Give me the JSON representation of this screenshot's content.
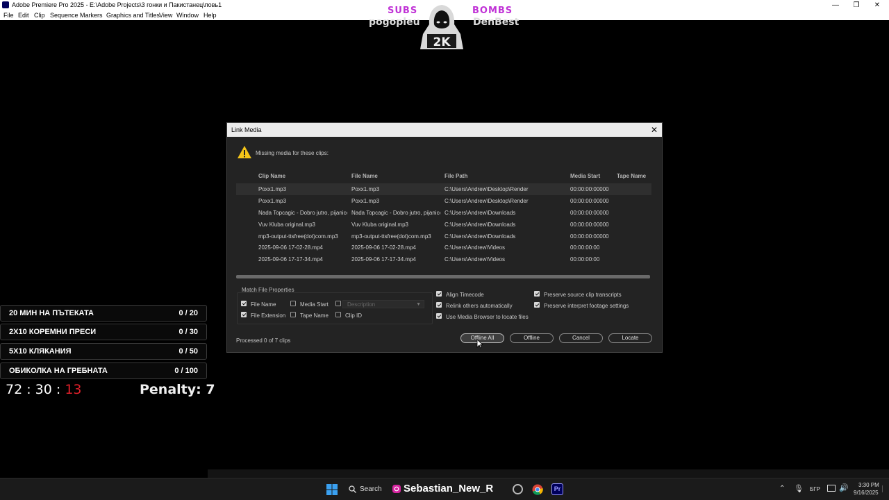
{
  "window": {
    "title": "Adobe Premiere Pro 2025 - E:\\Adobe Projects\\3 гонки и Пакистанец\\повь1",
    "controls": {
      "minimize": "—",
      "maximize": "❐",
      "close": "✕"
    }
  },
  "menu": [
    "File",
    "Edit",
    "Clip",
    "Sequence",
    "Markers",
    "Graphics and Titles",
    "View",
    "Window",
    "Help"
  ],
  "overlay": {
    "subs_label": "SUBS",
    "bombs_label": "BOMBS",
    "subs_name": "pogopleu",
    "bombs_name": "DenBest",
    "mascot_text": "2K",
    "challenges": [
      {
        "label": "20 МИН НА ПЪТЕКАТА",
        "count": "0 / 20"
      },
      {
        "label": "2X10 КОРЕМНИ ПРЕСИ",
        "count": "0 / 30"
      },
      {
        "label": "5X10 КЛЯКАНИЯ",
        "count": "0 / 50"
      },
      {
        "label": "ОБИКОЛКА НА ГРЕБНАТА",
        "count": "0 / 100"
      }
    ],
    "timer_main": "72 : 30 :",
    "timer_red": "13",
    "penalty": "Penalty: 7"
  },
  "dialog": {
    "title": "Link Media",
    "close": "✕",
    "message": "Missing media for these clips:",
    "columns": [
      "Clip Name",
      "File Name",
      "File Path",
      "Media Start",
      "Tape Name"
    ],
    "rows": [
      {
        "clip": "Poxx1.mp3",
        "file": "Poxx1.mp3",
        "path": "C:\\Users\\Andrew\\Desktop\\Render",
        "start": "00:00:00:00000",
        "tape": ""
      },
      {
        "clip": "Poxx1.mp3",
        "file": "Poxx1.mp3",
        "path": "C:\\Users\\Andrew\\Desktop\\Render",
        "start": "00:00:00:00000",
        "tape": ""
      },
      {
        "clip": "Nada Topcagic - Dobro jutro, pijanice -",
        "file": "Nada Topcagic - Dobro jutro, pijanice -",
        "path": "C:\\Users\\Andrew\\Downloads",
        "start": "00:00:00:00000",
        "tape": ""
      },
      {
        "clip": "Vuv Kluba original.mp3",
        "file": "Vuv Kluba original.mp3",
        "path": "C:\\Users\\Andrew\\Downloads",
        "start": "00:00:00:00000",
        "tape": ""
      },
      {
        "clip": "mp3-output-ttsfree(dot)com.mp3",
        "file": "mp3-output-ttsfree(dot)com.mp3",
        "path": "C:\\Users\\Andrew\\Downloads",
        "start": "00:00:00:00000",
        "tape": ""
      },
      {
        "clip": "2025-09-06 17-02-28.mp4",
        "file": "2025-09-06 17-02-28.mp4",
        "path": "C:\\Users\\Andrew\\Videos",
        "start": "00:00:00:00",
        "tape": ""
      },
      {
        "clip": "2025-09-06 17-17-34.mp4",
        "file": "2025-09-06 17-17-34.mp4",
        "path": "C:\\Users\\Andrew\\Videos",
        "start": "00:00:00:00",
        "tape": ""
      }
    ],
    "match_title": "Match File Properties",
    "match": {
      "file_name": {
        "label": "File Name",
        "checked": true
      },
      "media_start": {
        "label": "Media Start",
        "checked": false
      },
      "description": {
        "label": "",
        "checked": false
      },
      "file_extension": {
        "label": "File Extension",
        "checked": true
      },
      "tape_name": {
        "label": "Tape Name",
        "checked": false
      },
      "clip_id": {
        "label": "Clip ID",
        "checked": false
      }
    },
    "description_placeholder": "Description",
    "options": {
      "align_timecode": {
        "label": "Align Timecode",
        "checked": true
      },
      "relink_others": {
        "label": "Relink others automatically",
        "checked": true
      },
      "use_media_browser": {
        "label": "Use Media Browser to locate files",
        "checked": true
      },
      "preserve_transcripts": {
        "label": "Preserve source clip transcripts",
        "checked": true
      },
      "preserve_interpret": {
        "label": "Preserve interpret footage settings",
        "checked": true
      }
    },
    "processed": "Processed 0 of 7 clips",
    "buttons": {
      "offline_all": "Offline All",
      "offline": "Offline",
      "cancel": "Cancel",
      "locate": "Locate"
    }
  },
  "taskbar": {
    "search_label": "Search",
    "media_title": "Sebastian_New_R",
    "language": "БГР",
    "time": "3:30 PM",
    "date": "9/16/2025"
  },
  "colors": {
    "accent_purple": "#c032d6",
    "timer_red": "#e0202a",
    "warning_yellow": "#f5c518"
  }
}
